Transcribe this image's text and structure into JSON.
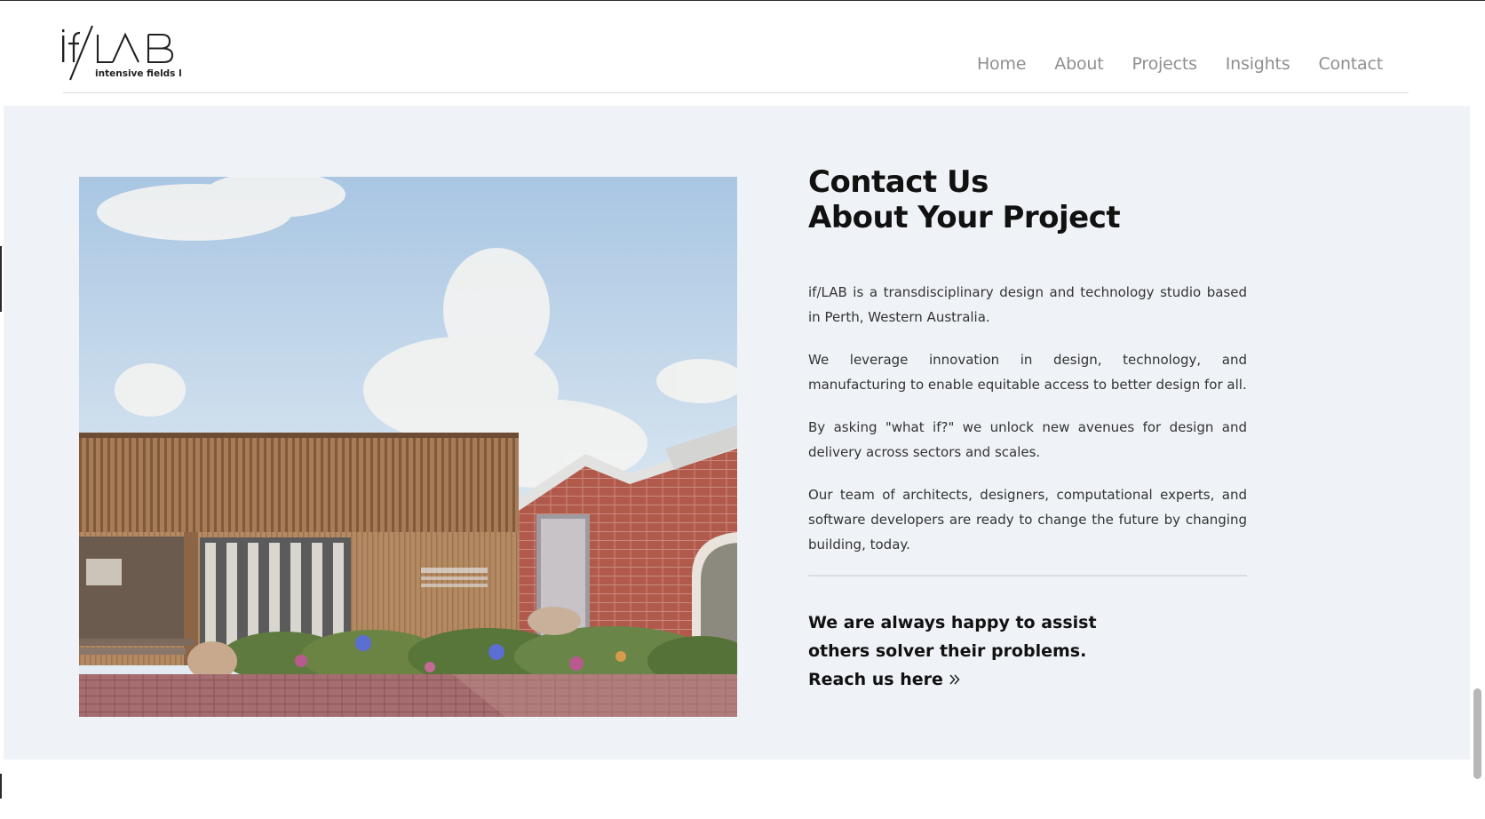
{
  "brand": {
    "logo_text": "if/LAB",
    "logo_tagline": "intensive fields lab"
  },
  "nav": {
    "items": [
      "Home",
      "About",
      "Projects",
      "Insights",
      "Contact"
    ]
  },
  "contact_section": {
    "heading_line1": "Contact Us",
    "heading_line2": "About Your Project",
    "paragraphs": [
      "if/LAB is a transdisciplinary design and technology studio based in Perth, Western Australia.",
      "We leverage innovation in design, technology, and manufacturing to enable equitable access to better design for all.",
      "By asking \"what if?\" we unlock new avenues for design and delivery across sectors and scales.",
      "Our team of architects, designers, computational experts, and software developers are ready to change the future by changing building, today."
    ],
    "cta_line1": "We are always happy to assist",
    "cta_line2": "others solver their problems.",
    "cta_link": "Reach us here"
  },
  "icons": {
    "cta_arrow": "double-chevron-right-icon"
  },
  "colors": {
    "section_bg": "#eff3f7",
    "nav_text": "#8f8f8f",
    "heading_text": "#111111",
    "body_text": "#333333"
  }
}
